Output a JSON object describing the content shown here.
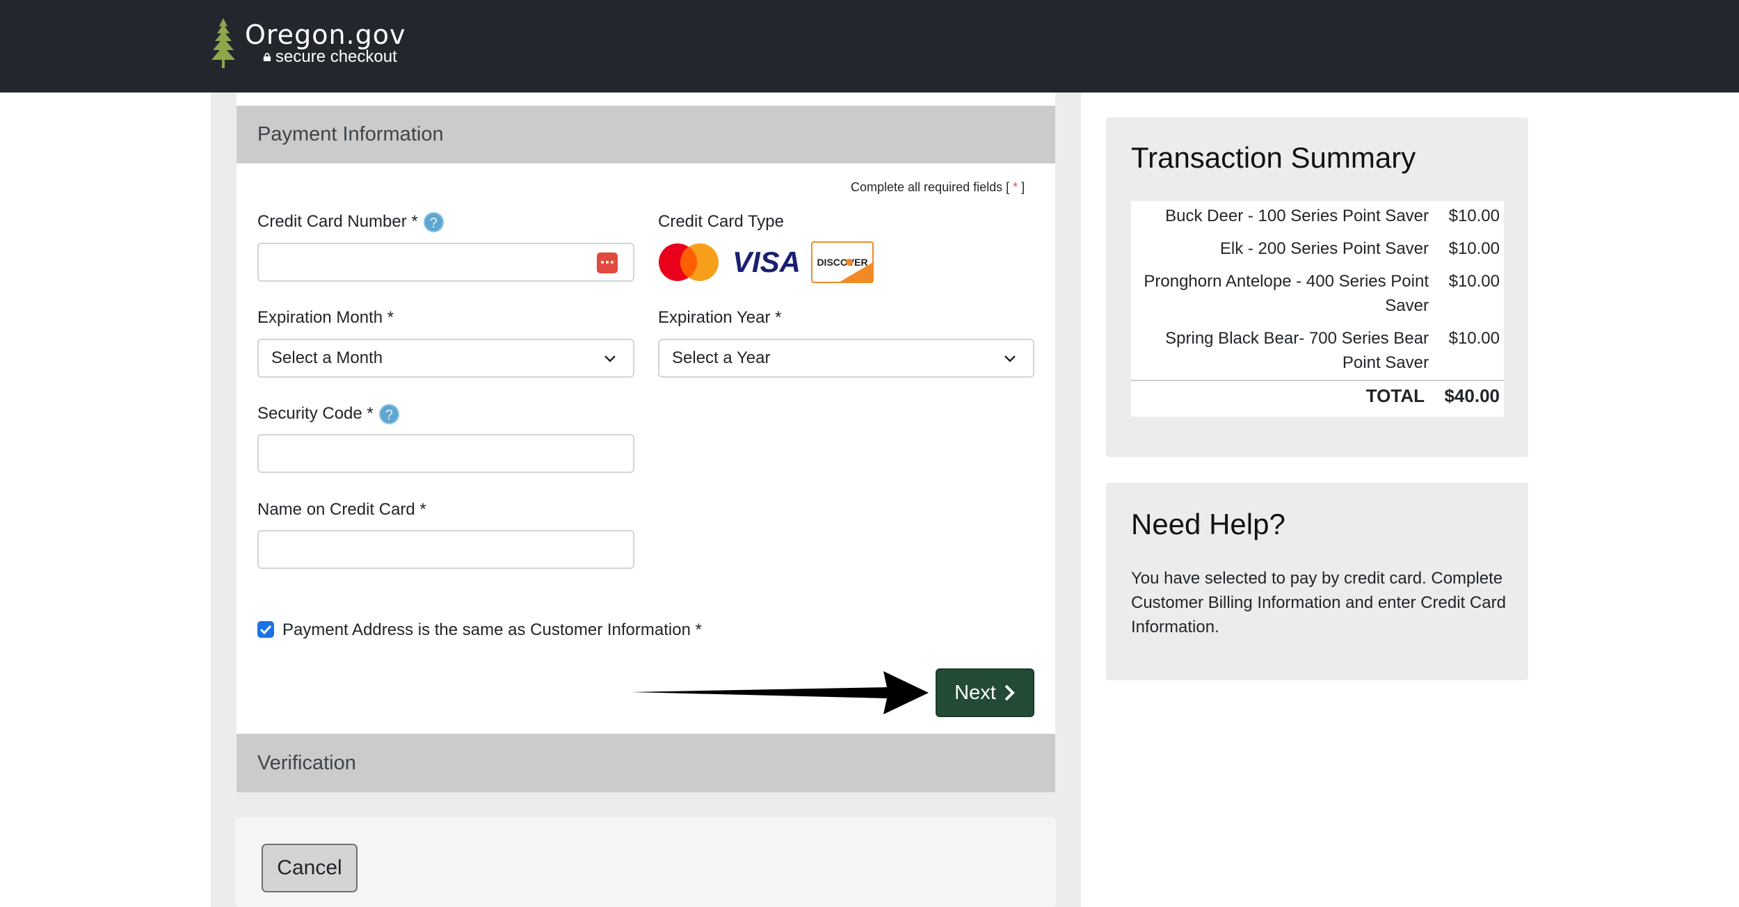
{
  "header": {
    "brand_name": "Oregon.gov",
    "brand_sub": "secure checkout",
    "bg_color": "#23272d"
  },
  "payment": {
    "section_title": "Payment Information",
    "required_note_prefix": "Complete all required fields [",
    "required_note_star": " * ",
    "required_note_suffix": "]",
    "cc_number_label": "Credit Card Number *",
    "cc_type_label": "Credit Card Type",
    "card_types": [
      "mastercard-icon",
      "visa-icon",
      "discover-icon"
    ],
    "visa_text": "VISA",
    "discover_text": "DISCOVER",
    "exp_month_label": "Expiration Month *",
    "exp_month_value": "Select a Month",
    "exp_year_label": "Expiration Year *",
    "exp_year_value": "Select a Year",
    "security_label": "Security Code *",
    "name_label": "Name on Credit Card *",
    "same_address_label": "Payment Address is the same as Customer Information *",
    "same_address_checked": true,
    "next_label": "Next",
    "help_glyph": "?"
  },
  "verification": {
    "section_title": "Verification"
  },
  "actions": {
    "cancel_label": "Cancel"
  },
  "summary": {
    "title": "Transaction Summary",
    "items": [
      {
        "name": "Buck Deer - 100 Series Point Saver",
        "amount": "$10.00"
      },
      {
        "name": "Elk - 200 Series Point Saver",
        "amount": "$10.00"
      },
      {
        "name": "Pronghorn Antelope - 400 Series Point Saver",
        "amount": "$10.00"
      },
      {
        "name": "Spring Black Bear- 700 Series Bear Point Saver",
        "amount": "$10.00"
      }
    ],
    "total_label": "TOTAL",
    "total_amount": "$40.00"
  },
  "help": {
    "title": "Need Help?",
    "text": "You have selected to pay by credit card. Complete Customer Billing Information and enter Credit Card Information."
  },
  "colors": {
    "accent_green": "#234a35",
    "checkbox_blue": "#1a73e8"
  }
}
